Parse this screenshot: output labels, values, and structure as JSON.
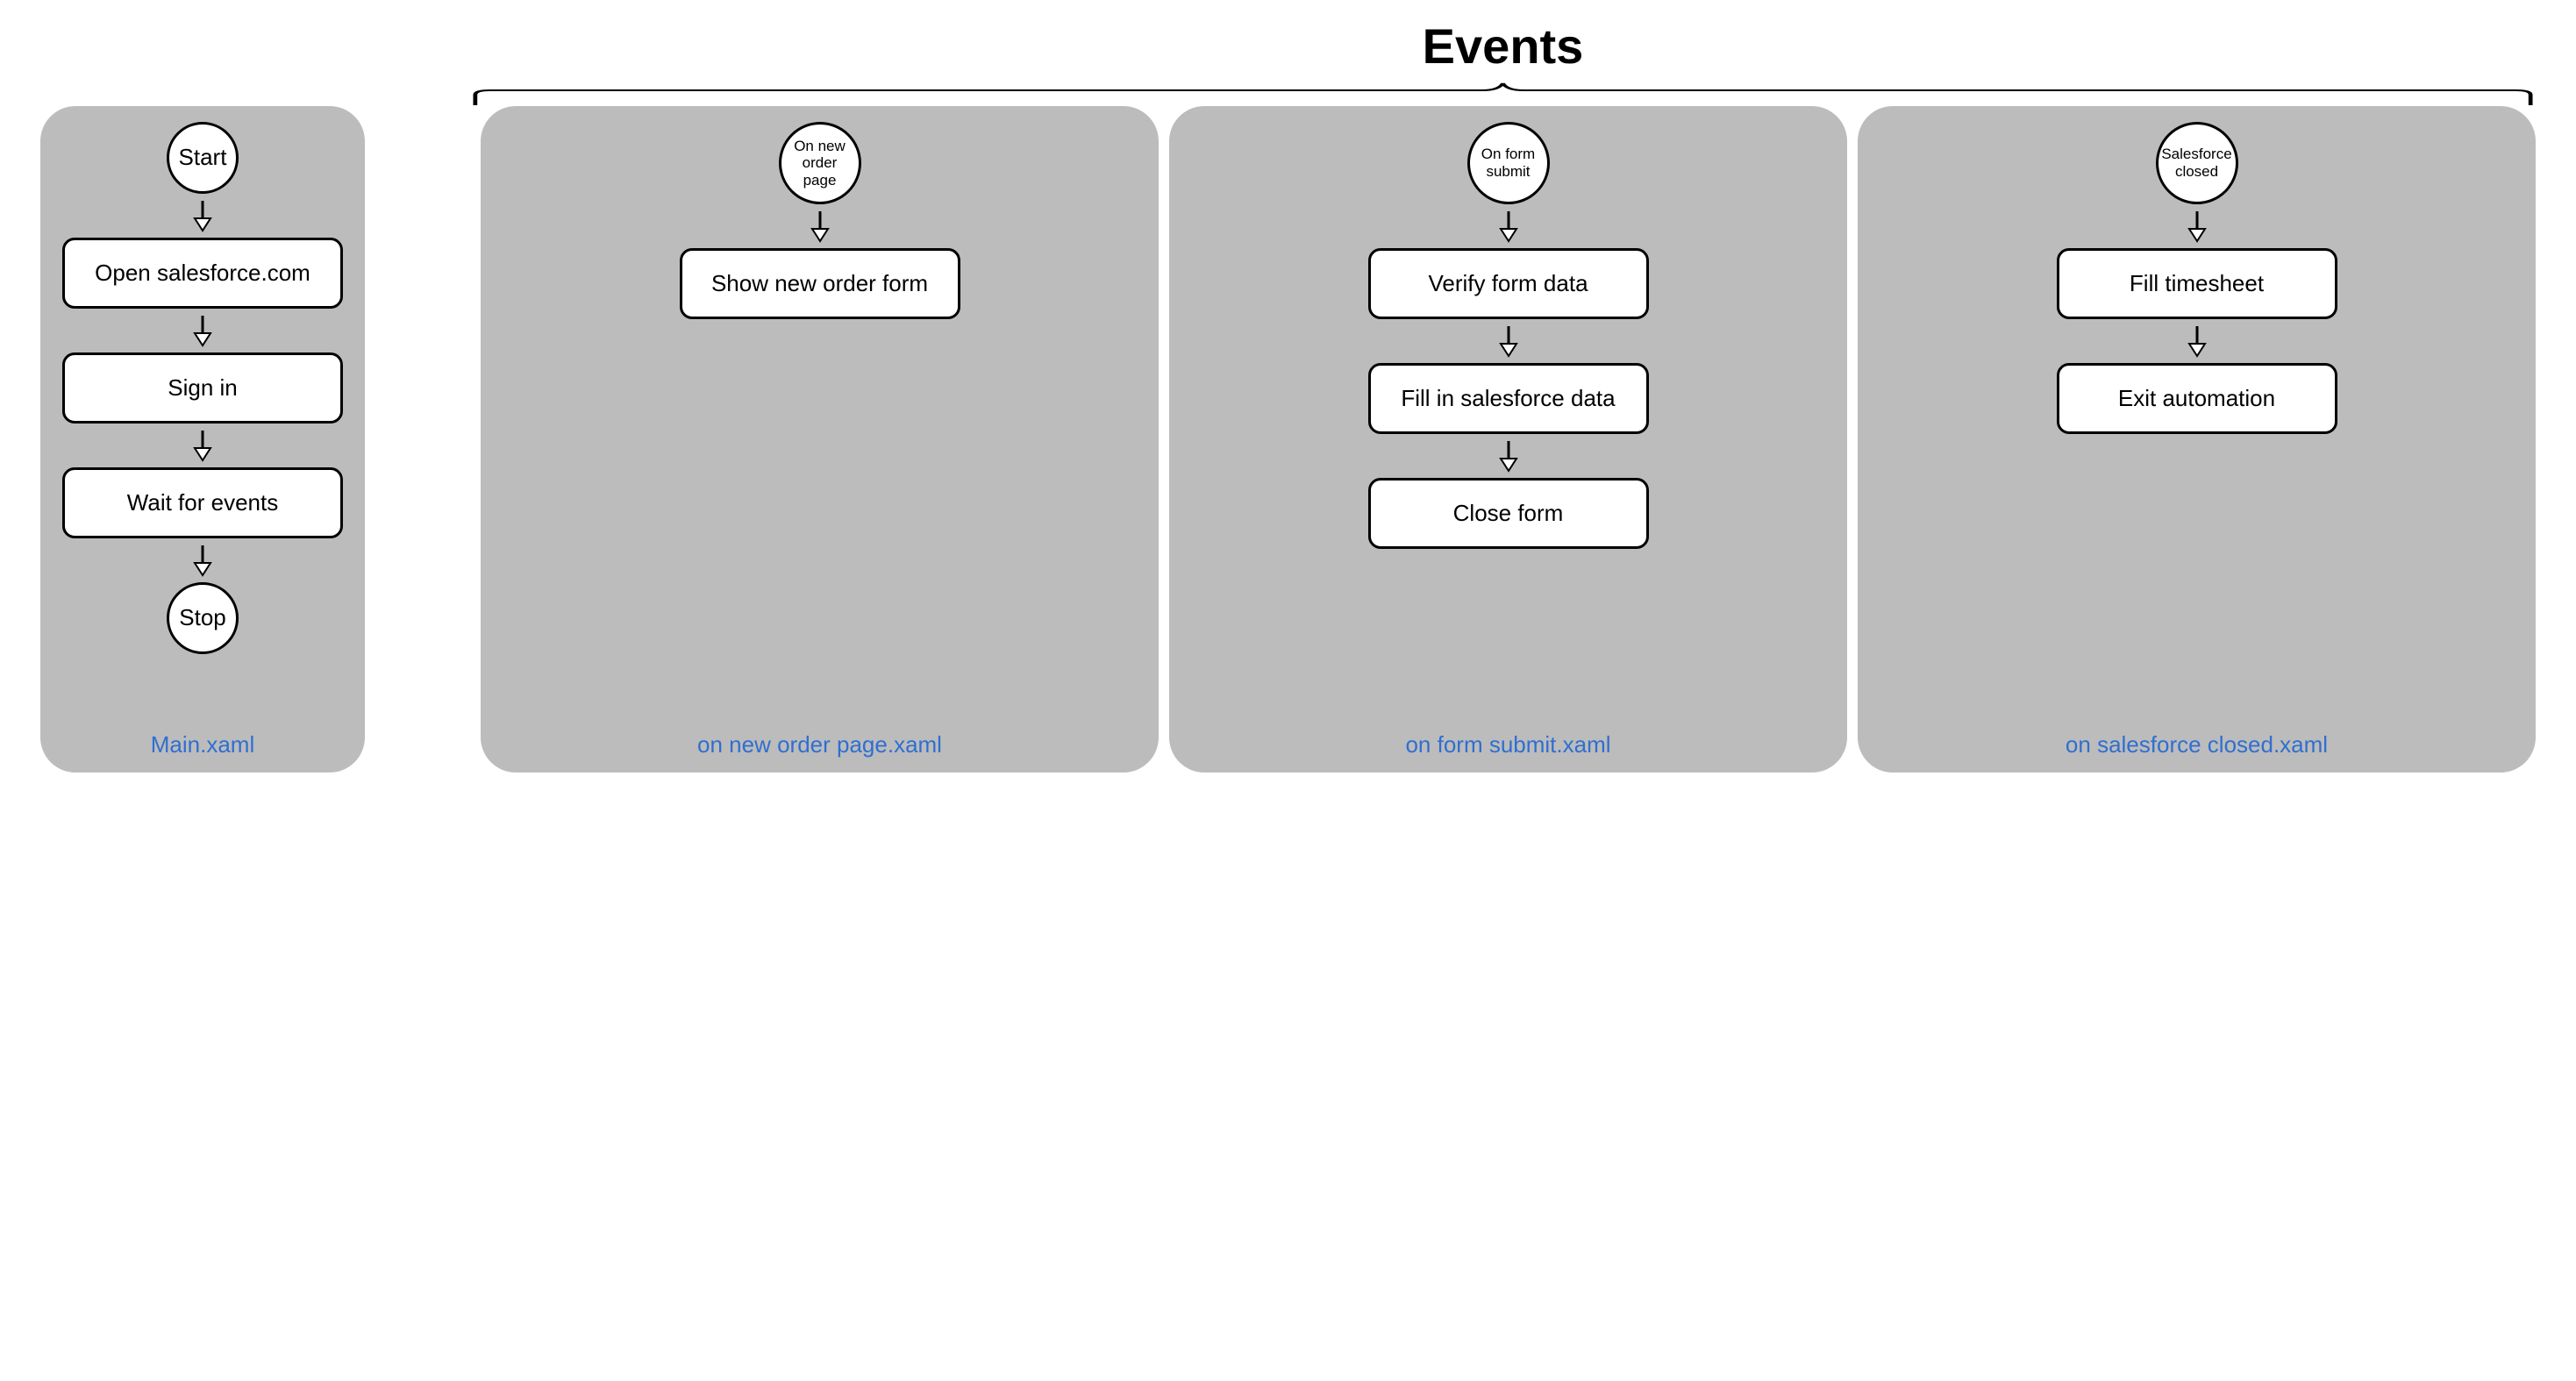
{
  "title": "Events",
  "main": {
    "start": "Start",
    "stop": "Stop",
    "steps": [
      "Open salesforce.com",
      "Sign in",
      "Wait for events"
    ],
    "caption": "Main.xaml"
  },
  "events": [
    {
      "trigger": "On new order page",
      "steps": [
        "Show new order form"
      ],
      "caption": "on new order page.xaml"
    },
    {
      "trigger": "On form submit",
      "steps": [
        "Verify form data",
        "Fill in salesforce data",
        "Close form"
      ],
      "caption": "on form submit.xaml"
    },
    {
      "trigger": "Salesforce closed",
      "steps": [
        "Fill timesheet",
        "Exit automation"
      ],
      "caption": "on salesforce closed.xaml"
    }
  ]
}
